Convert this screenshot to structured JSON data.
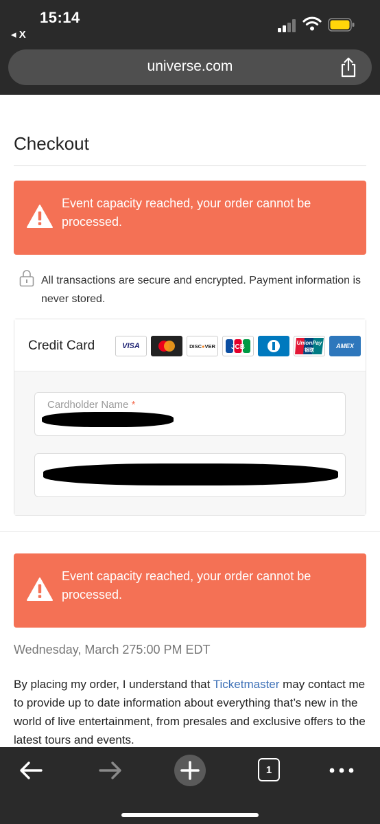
{
  "status_bar": {
    "time": "15:14",
    "back_label": "◂ X"
  },
  "browser": {
    "url": "universe.com"
  },
  "page": {
    "title": "Checkout",
    "alert_top": "Event capacity reached, your order cannot be processed.",
    "alert_bottom": "Event capacity reached, your order cannot be processed.",
    "secure_note": "All transactions are secure and encrypted. Payment information is never stored.",
    "card_section": {
      "title": "Credit Card",
      "logos": [
        "VISA",
        "Mastercard",
        "DISCOVER",
        "JCB",
        "Diners Club",
        "UnionPay",
        "AMEX"
      ],
      "fields": {
        "cardholder_label": "Cardholder Name",
        "required_mark": "*"
      }
    },
    "event_date": "Wednesday, March 275:00 PM EDT",
    "disclaimer": {
      "before": "By placing my order, I understand that ",
      "link": "Ticketmaster",
      "after": " may contact me to provide up to date information about everything that’s new in the world of live entertainment, from presales and exclusive offers to the latest tours and events."
    }
  },
  "toolbar": {
    "tab_count": "1"
  },
  "colors": {
    "alert_bg": "#f47155",
    "chrome_bg": "#2a2a2a",
    "link": "#3b6fb6",
    "battery": "#ffd60a"
  }
}
